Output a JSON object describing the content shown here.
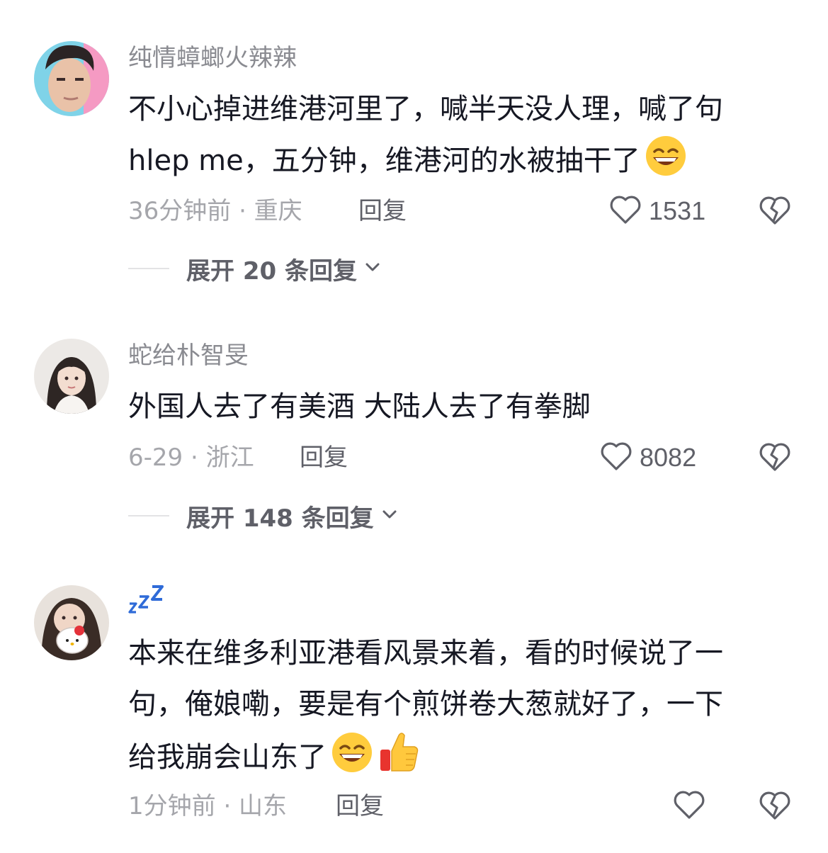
{
  "comments": [
    {
      "username": "纯情蟑螂火辣辣",
      "text_line1": "不小心掉进维港河里了，喊半天没人理，喊了句",
      "text_line2": "hlep me，五分钟，维港河的水被抽干了",
      "time_location": "36分钟前 · 重庆",
      "reply_label": "回复",
      "likes": "1531",
      "expand_label": "展开 20 条回复",
      "emojis": [
        "grin-emoji"
      ]
    },
    {
      "username": "蛇给朴智旻",
      "text_line1": "外国人去了有美酒 大陆人去了有拳脚",
      "time_location": "6-29 · 浙江",
      "reply_label": "回复",
      "likes": "8082",
      "expand_label": "展开 148 条回复"
    },
    {
      "username": "zzz",
      "text_line1": "本来在维多利亚港看风景来着，看的时候说了一",
      "text_line2": "句，俺娘嘞，要是有个煎饼卷大葱就好了，一下",
      "text_line3": "给我崩会山东了",
      "time_location": "1分钟前 · 山东",
      "reply_label": "回复",
      "likes": "",
      "emojis": [
        "grin-emoji",
        "thumbs-up-emoji"
      ]
    }
  ],
  "colors": {
    "text_primary": "#161823",
    "text_secondary": "#8a8b91",
    "meta": "#a5a6ab",
    "action": "#5f6068",
    "divider": "#e3e3e5",
    "zzz_blue": "#2f6bd8"
  },
  "icons": [
    "heart-outline-icon",
    "broken-heart-icon",
    "chevron-down-icon"
  ]
}
